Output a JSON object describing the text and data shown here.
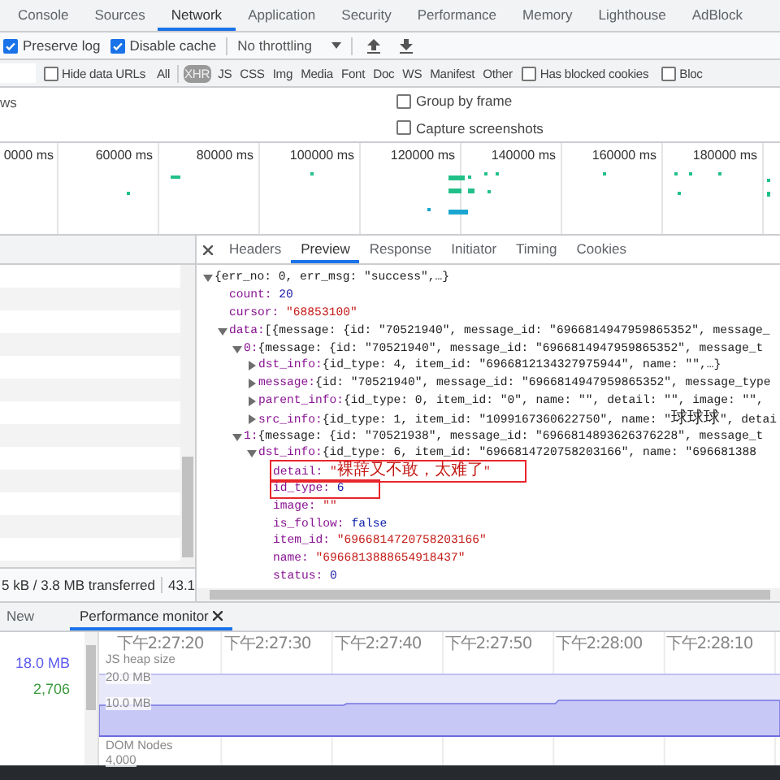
{
  "tabs": [
    {
      "label": "Console",
      "selected": false
    },
    {
      "label": "Sources",
      "selected": false
    },
    {
      "label": "Network",
      "selected": true
    },
    {
      "label": "Application",
      "selected": false
    },
    {
      "label": "Security",
      "selected": false
    },
    {
      "label": "Performance",
      "selected": false
    },
    {
      "label": "Memory",
      "selected": false
    },
    {
      "label": "Lighthouse",
      "selected": false
    },
    {
      "label": "AdBlock",
      "selected": false
    }
  ],
  "toolbar": {
    "checkboxes": [
      {
        "label": "Preserve log",
        "checked": true
      },
      {
        "label": "Disable cache",
        "checked": true
      }
    ],
    "throttling": "No throttling"
  },
  "filter": {
    "hide_data_urls": {
      "label": "Hide data URLs",
      "checked": false
    },
    "types": [
      {
        "label": "All",
        "selected": false
      },
      {
        "label": "XHR",
        "selected": true
      },
      {
        "label": "JS",
        "selected": false
      },
      {
        "label": "CSS",
        "selected": false
      },
      {
        "label": "Img",
        "selected": false
      },
      {
        "label": "Media",
        "selected": false
      },
      {
        "label": "Font",
        "selected": false
      },
      {
        "label": "Doc",
        "selected": false
      },
      {
        "label": "WS",
        "selected": false
      },
      {
        "label": "Manifest",
        "selected": false
      },
      {
        "label": "Other",
        "selected": false
      }
    ],
    "extra_checkboxes": [
      {
        "label": "Has blocked cookies",
        "checked": false
      },
      {
        "label": "Bloc",
        "checked": false
      }
    ]
  },
  "options": {
    "left_text": "ws",
    "checkboxes": [
      {
        "label": "Group by frame",
        "checked": false
      },
      {
        "label": "Capture screenshots",
        "checked": false
      }
    ]
  },
  "overview": {
    "ticks": [
      "0000 ms",
      "60000 ms",
      "80000 ms",
      "100000 ms",
      "120000 ms",
      "140000 ms",
      "160000 ms",
      "180000 ms"
    ]
  },
  "requests": {
    "summary": "5 kB / 3.8 MB transferred",
    "summary_2": "43.1"
  },
  "details": {
    "tabs": [
      {
        "label": "Headers",
        "selected": false
      },
      {
        "label": "Preview",
        "selected": true
      },
      {
        "label": "Response",
        "selected": false
      },
      {
        "label": "Initiator",
        "selected": false
      },
      {
        "label": "Timing",
        "selected": false
      },
      {
        "label": "Cookies",
        "selected": false
      }
    ],
    "tree": [
      {
        "kind": "object",
        "summary": "{err_no: 0, err_msg: \"success\",…}",
        "expanded": true,
        "children": [
          {
            "kind": "number",
            "key": "count:",
            "value": "20"
          },
          {
            "kind": "string",
            "key": "cursor:",
            "value": "\"68853100\""
          },
          {
            "kind": "object",
            "key": "data:",
            "summary": "[{message: {id: \"70521940\", message_id: \"6966814947959865352\", message_",
            "expanded": true,
            "children": [
              {
                "kind": "object",
                "key": "0:",
                "summary": "{message: {id: \"70521940\", message_id: \"6966814947959865352\", message_t",
                "expanded": true,
                "children": [
                  {
                    "kind": "object",
                    "key": "dst_info:",
                    "summary": "{id_type: 4, item_id: \"6966812134327975944\", name: \"\",…}",
                    "expanded": false
                  },
                  {
                    "kind": "object",
                    "key": "message:",
                    "summary": "{id: \"70521940\", message_id: \"6966814947959865352\", message_type",
                    "expanded": false
                  },
                  {
                    "kind": "object",
                    "key": "parent_info:",
                    "summary": "{id_type: 0, item_id: \"0\", name: \"\", detail: \"\", image: \"\",",
                    "expanded": false
                  },
                  {
                    "kind": "object",
                    "key": "src_info:",
                    "summary": "{id_type: 1, item_id: \"1099167360622750\", name: \"球球球\", detai",
                    "expanded": false
                  }
                ]
              },
              {
                "kind": "object",
                "key": "1:",
                "summary": "{message: {id: \"70521938\", message_id: \"6966814893626376228\", message_t",
                "expanded": true,
                "children": [
                  {
                    "kind": "object",
                    "key": "dst_info:",
                    "summary": "{id_type: 6, item_id: \"6966814720758203166\", name: \"696681388",
                    "expanded": true,
                    "children": [
                      {
                        "kind": "string",
                        "key": "detail:",
                        "value": "\"裸辞又不敢，太难了\"",
                        "highlighted": true
                      },
                      {
                        "kind": "number",
                        "key": "id_type:",
                        "value": "6",
                        "highlighted": true
                      },
                      {
                        "kind": "string",
                        "key": "image:",
                        "value": "\"\"",
                        "highlighted": false
                      },
                      {
                        "kind": "boolean",
                        "key": "is_follow:",
                        "value": "false",
                        "highlighted": false
                      },
                      {
                        "kind": "string",
                        "key": "item_id:",
                        "value": "\"6966814720758203166\"",
                        "highlighted": false
                      },
                      {
                        "kind": "string",
                        "key": "name:",
                        "value": "\"6966813888654918437\"",
                        "highlighted": false
                      },
                      {
                        "kind": "number",
                        "key": "status:",
                        "value": "0",
                        "highlighted": false
                      }
                    ]
                  }
                ]
              }
            ]
          }
        ]
      }
    ]
  },
  "drawer": {
    "tabs": [
      {
        "label": "New",
        "selected": false,
        "closable": false
      },
      {
        "label": "Performance monitor",
        "selected": true,
        "closable": true
      }
    ],
    "metrics": [
      {
        "value": "18.0 MB",
        "color": "#5b5bf0"
      },
      {
        "value": "2,706",
        "color": "#3c9a3c"
      }
    ],
    "times": [
      "下午2:27:20",
      "下午2:27:30",
      "下午2:27:40",
      "下午2:27:50",
      "下午2:28:00",
      "下午2:28:10"
    ],
    "heap_label": "JS heap size",
    "heap_max": "20.0 MB",
    "heap_mid": "10.0 MB",
    "dom_label": "DOM Nodes",
    "dom_max": "4,000"
  }
}
